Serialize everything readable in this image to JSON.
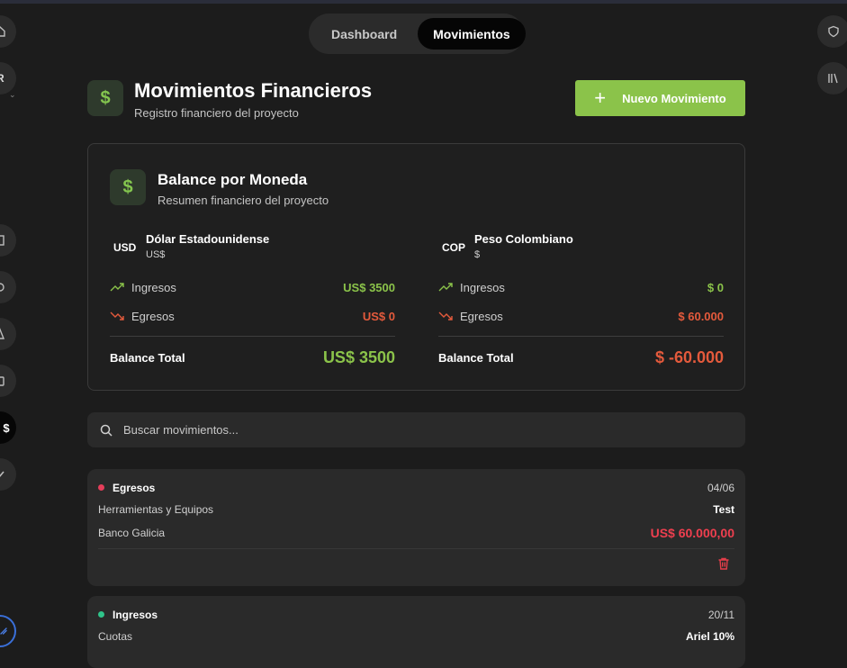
{
  "tabs": [
    {
      "label": "Dashboard",
      "active": false
    },
    {
      "label": "Movimientos",
      "active": true
    }
  ],
  "left_rail": {
    "letter": "R",
    "active_glyph": "$"
  },
  "header": {
    "icon": "dollar-icon",
    "title": "Movimientos Financieros",
    "subtitle": "Registro financiero del proyecto",
    "new_button_label": "Nuevo Movimiento",
    "new_button_icon": "plus-icon"
  },
  "balance": {
    "title": "Balance por Moneda",
    "subtitle": "Resumen financiero del proyecto",
    "currencies": [
      {
        "code": "USD",
        "name": "Dólar Estadounidense",
        "symbol": "US$",
        "income_label": "Ingresos",
        "income_value": "US$ 3500",
        "expense_label": "Egresos",
        "expense_value": "US$ 0",
        "total_label": "Balance Total",
        "total_value": "US$ 3500",
        "total_status": "positive"
      },
      {
        "code": "COP",
        "name": "Peso Colombiano",
        "symbol": "$",
        "income_label": "Ingresos",
        "income_value": "$ 0",
        "expense_label": "Egresos",
        "expense_value": "$ 60.000",
        "total_label": "Balance Total",
        "total_value": "$ -60.000",
        "total_status": "negative"
      }
    ]
  },
  "search": {
    "placeholder": "Buscar movimientos...",
    "value": ""
  },
  "movements": [
    {
      "type": "Egresos",
      "type_color": "#e53e5a",
      "date": "04/06",
      "category": "Herramientas y Equipos",
      "description": "Test",
      "account": "Banco Galicia",
      "amount": "US$ 60.000,00"
    },
    {
      "type": "Ingresos",
      "type_color": "#2fc48a",
      "date": "20/11",
      "category": "Cuotas",
      "description": "Ariel 10%"
    }
  ],
  "colors": {
    "accent": "#8bc34a",
    "positive": "#8bc34a",
    "negative": "#e45a3c",
    "expense_amount": "#ef3f4f",
    "background": "#1c1c1c"
  }
}
